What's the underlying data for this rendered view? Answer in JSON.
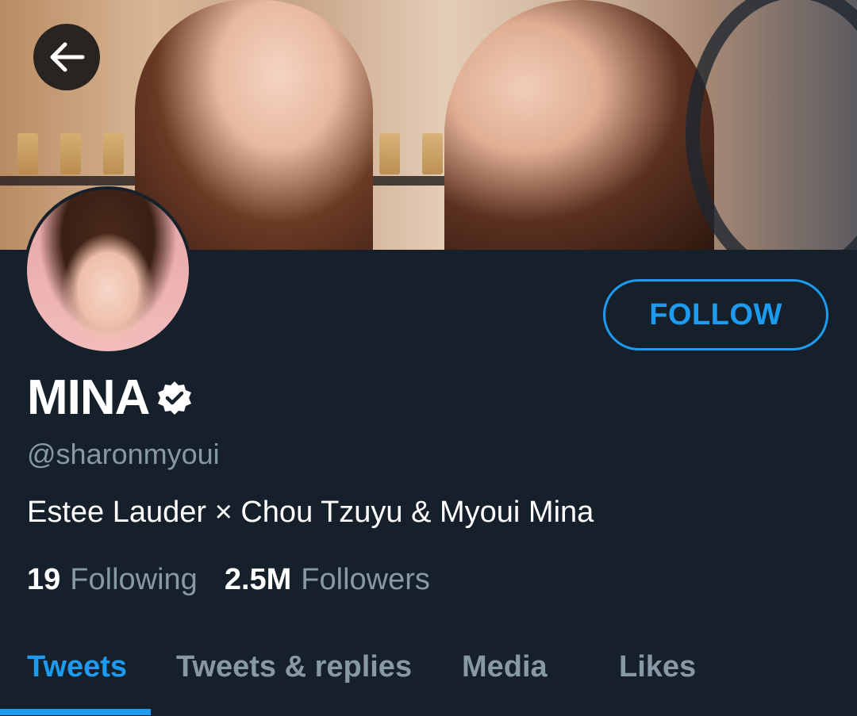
{
  "profile": {
    "display_name": "MINA",
    "handle": "@sharonmyoui",
    "bio": "Estee Lauder × Chou Tzuyu & Myoui Mina",
    "verified": true,
    "follow_label": "FOLLOW"
  },
  "stats": {
    "following_count": "19",
    "following_label": "Following",
    "followers_count": "2.5M",
    "followers_label": "Followers"
  },
  "tabs": [
    {
      "label": "Tweets",
      "active": true
    },
    {
      "label": "Tweets & replies",
      "active": false
    },
    {
      "label": "Media",
      "active": false
    },
    {
      "label": "Likes",
      "active": false
    }
  ],
  "colors": {
    "background": "#15202b",
    "accent": "#1d9bf0",
    "secondary_text": "#8899a6",
    "primary_text": "#ffffff"
  },
  "icons": {
    "back": "arrow-left-icon",
    "verified": "verified-badge-icon"
  }
}
